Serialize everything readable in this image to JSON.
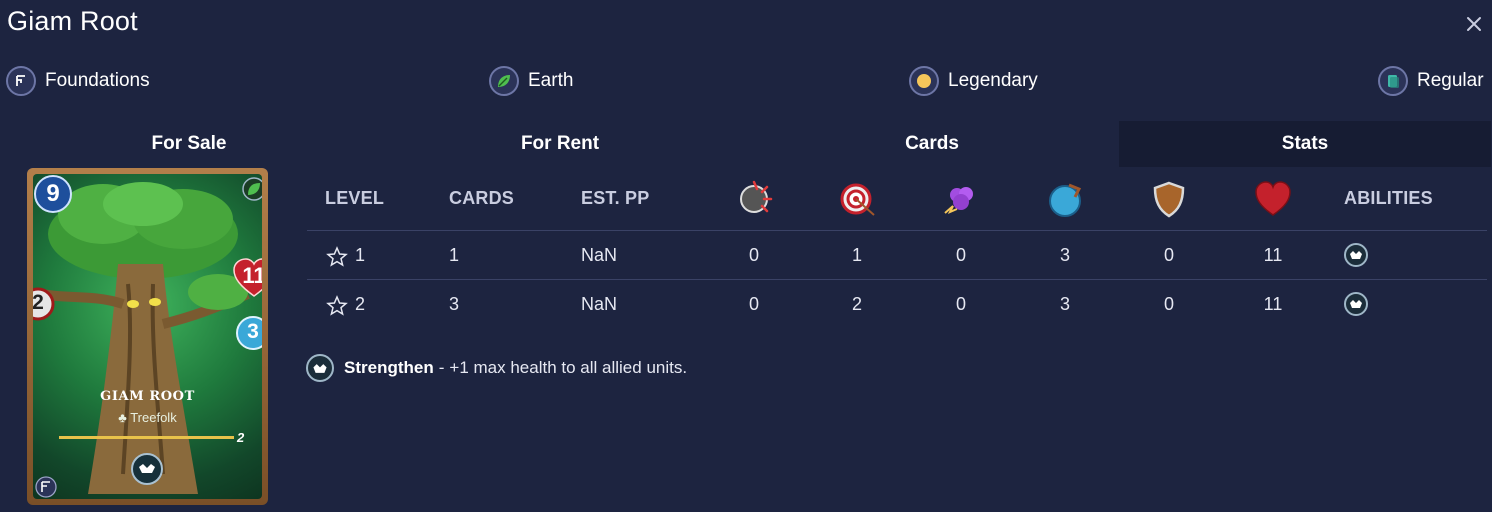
{
  "title": "Giam Root",
  "meta": {
    "edition": "Foundations",
    "element": "Earth",
    "rarity": "Legendary",
    "foil": "Regular"
  },
  "tabs": [
    "For Sale",
    "For Rent",
    "Cards",
    "Stats"
  ],
  "active_tab": "Stats",
  "card": {
    "mana": "9",
    "health": "11",
    "ranged": "2",
    "speed": "3",
    "name": "GIAM ROOT",
    "type": "Treefolk",
    "level": "2"
  },
  "table": {
    "headers": [
      "LEVEL",
      "CARDS",
      "EST. PP",
      "ABILITIES"
    ],
    "stat_icons": [
      "melee-attack-icon",
      "ranged-attack-icon",
      "magic-attack-icon",
      "speed-icon",
      "armor-icon",
      "health-icon"
    ],
    "rows": [
      {
        "level": "1",
        "cards": "1",
        "est_pp": "NaN",
        "melee": "0",
        "ranged": "1",
        "magic": "0",
        "speed": "3",
        "armor": "0",
        "health": "11"
      },
      {
        "level": "2",
        "cards": "3",
        "est_pp": "NaN",
        "melee": "0",
        "ranged": "2",
        "magic": "0",
        "speed": "3",
        "armor": "0",
        "health": "11"
      }
    ]
  },
  "ability": {
    "name": "Strengthen",
    "separator": "-",
    "description": "+1 max health to all allied units."
  },
  "colors": {
    "background": "#1d2440",
    "active_tab": "#161c33",
    "divider": "#3a4266",
    "rarity_gold": "#f5c65a",
    "earth_green": "#4fbf4f"
  }
}
